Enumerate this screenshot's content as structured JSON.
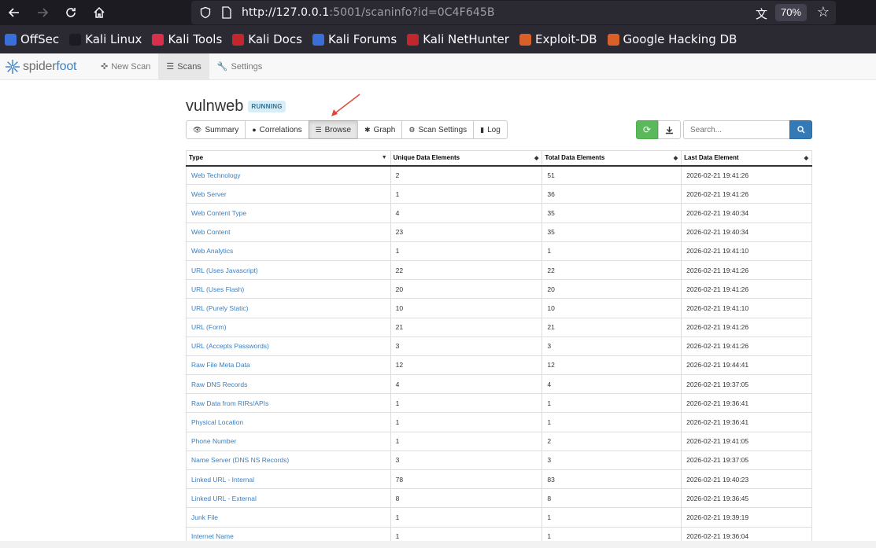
{
  "browser": {
    "url_host": "http://127.0.0.1",
    "url_rest": ":5001/scaninfo?id=0C4F645B",
    "zoom": "70%",
    "bookmarks": [
      {
        "label": "OffSec",
        "color": "#3b6fd8"
      },
      {
        "label": "Kali Linux",
        "color": "#1c1b22"
      },
      {
        "label": "Kali Tools",
        "color": "#d8304a"
      },
      {
        "label": "Kali Docs",
        "color": "#c4262d"
      },
      {
        "label": "Kali Forums",
        "color": "#3b6fd8"
      },
      {
        "label": "Kali NetHunter",
        "color": "#c4262d"
      },
      {
        "label": "Exploit-DB",
        "color": "#d8612a"
      },
      {
        "label": "Google Hacking DB",
        "color": "#d8612a"
      }
    ]
  },
  "nav": {
    "brand_a": "spider",
    "brand_b": "foot",
    "items": [
      {
        "label": "New Scan",
        "icon": "crosshair-icon"
      },
      {
        "label": "Scans",
        "icon": "list-icon"
      },
      {
        "label": "Settings",
        "icon": "wrench-icon"
      }
    ]
  },
  "scan": {
    "name": "vulnweb",
    "status": "RUNNING"
  },
  "tabs": [
    {
      "label": "Summary",
      "glyph": "👁",
      "name": "tab-summary"
    },
    {
      "label": "Correlations",
      "glyph": "●",
      "name": "tab-correlations"
    },
    {
      "label": "Browse",
      "glyph": "☰",
      "name": "tab-browse"
    },
    {
      "label": "Graph",
      "glyph": "✱",
      "name": "tab-graph"
    },
    {
      "label": "Scan Settings",
      "glyph": "⚙",
      "name": "tab-scan-settings"
    },
    {
      "label": "Log",
      "glyph": "▮",
      "name": "tab-log"
    }
  ],
  "active_tab": "Browse",
  "search": {
    "placeholder": "Search..."
  },
  "table": {
    "headers": [
      "Type",
      "Unique Data Elements",
      "Total Data Elements",
      "Last Data Element"
    ],
    "rows": [
      [
        "Web Technology",
        "2",
        "51",
        "2026-02-21 19:41:26"
      ],
      [
        "Web Server",
        "1",
        "36",
        "2026-02-21 19:41:26"
      ],
      [
        "Web Content Type",
        "4",
        "35",
        "2026-02-21 19:40:34"
      ],
      [
        "Web Content",
        "23",
        "35",
        "2026-02-21 19:40:34"
      ],
      [
        "Web Analytics",
        "1",
        "1",
        "2026-02-21 19:41:10"
      ],
      [
        "URL (Uses Javascript)",
        "22",
        "22",
        "2026-02-21 19:41:26"
      ],
      [
        "URL (Uses Flash)",
        "20",
        "20",
        "2026-02-21 19:41:26"
      ],
      [
        "URL (Purely Static)",
        "10",
        "10",
        "2026-02-21 19:41:10"
      ],
      [
        "URL (Form)",
        "21",
        "21",
        "2026-02-21 19:41:26"
      ],
      [
        "URL (Accepts Passwords)",
        "3",
        "3",
        "2026-02-21 19:41:26"
      ],
      [
        "Raw File Meta Data",
        "12",
        "12",
        "2026-02-21 19:44:41"
      ],
      [
        "Raw DNS Records",
        "4",
        "4",
        "2026-02-21 19:37:05"
      ],
      [
        "Raw Data from RIRs/APIs",
        "1",
        "1",
        "2026-02-21 19:36:41"
      ],
      [
        "Physical Location",
        "1",
        "1",
        "2026-02-21 19:36:41"
      ],
      [
        "Phone Number",
        "1",
        "2",
        "2026-02-21 19:41:05"
      ],
      [
        "Name Server (DNS NS Records)",
        "3",
        "3",
        "2026-02-21 19:37:05"
      ],
      [
        "Linked URL - Internal",
        "78",
        "83",
        "2026-02-21 19:40:23"
      ],
      [
        "Linked URL - External",
        "8",
        "8",
        "2026-02-21 19:36:45"
      ],
      [
        "Junk File",
        "1",
        "1",
        "2026-02-21 19:39:19"
      ],
      [
        "Internet Name",
        "1",
        "1",
        "2026-02-21 19:36:04"
      ]
    ]
  },
  "colors": {
    "link": "#3a7fc0",
    "accent_green": "#5cb85c",
    "accent_blue": "#337ab7",
    "annotation_arrow": "#e0473c"
  }
}
